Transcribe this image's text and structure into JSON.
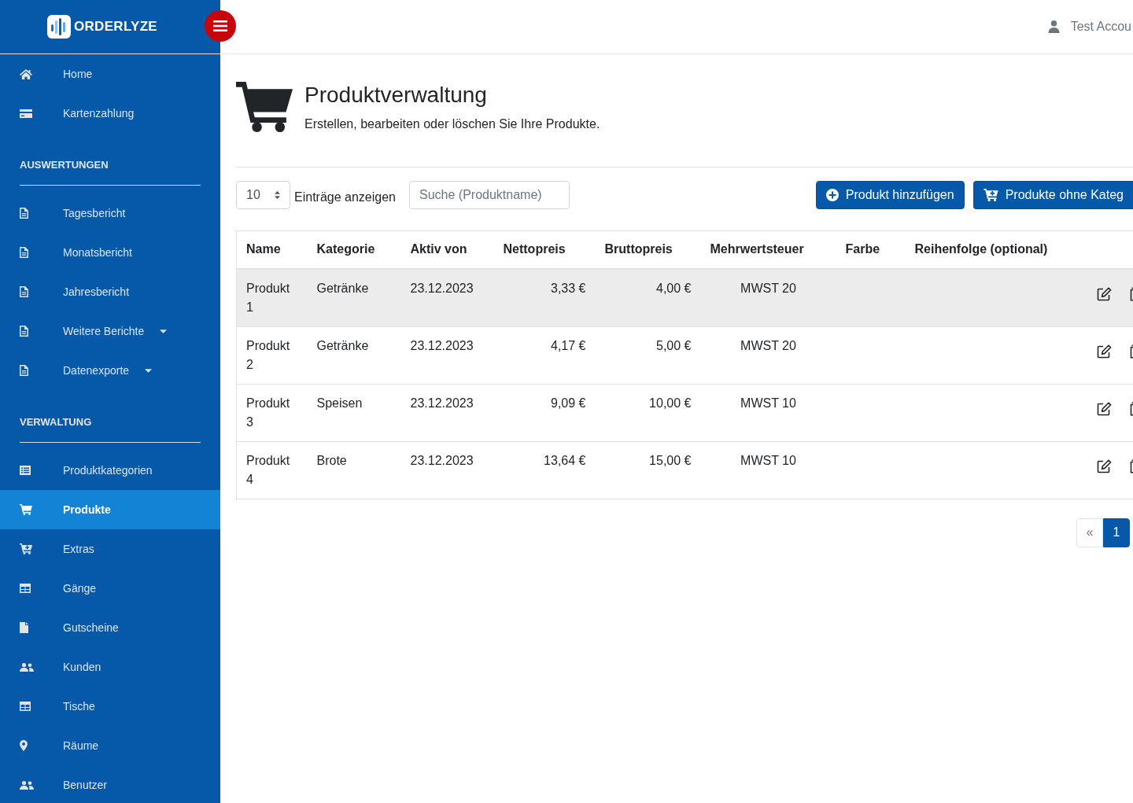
{
  "topbar": {
    "account": "Test Accou"
  },
  "sidebar": {
    "logo": "ORDERLYZE",
    "items": [
      {
        "label": "Home",
        "selected": false,
        "expandable": false
      },
      {
        "label": "Kartenzahlung",
        "selected": false,
        "expandable": false
      }
    ],
    "sections": [
      {
        "title": "AUSWERTUNGEN",
        "items": [
          {
            "label": "Tagesbericht",
            "selected": false,
            "expandable": false
          },
          {
            "label": "Monatsbericht",
            "selected": false,
            "expandable": false
          },
          {
            "label": "Jahresbericht",
            "selected": false,
            "expandable": false
          },
          {
            "label": "Weitere Berichte",
            "selected": false,
            "expandable": true
          },
          {
            "label": "Datenexporte",
            "selected": false,
            "expandable": true
          }
        ]
      },
      {
        "title": "VERWALTUNG",
        "items": [
          {
            "label": "Produktkategorien",
            "selected": false,
            "expandable": false
          },
          {
            "label": "Produkte",
            "selected": true,
            "expandable": false
          },
          {
            "label": "Extras",
            "selected": false,
            "expandable": false
          },
          {
            "label": "Gänge",
            "selected": false,
            "expandable": false
          },
          {
            "label": "Gutscheine",
            "selected": false,
            "expandable": false
          },
          {
            "label": "Kunden",
            "selected": false,
            "expandable": false
          },
          {
            "label": "Tische",
            "selected": false,
            "expandable": false
          },
          {
            "label": "Räume",
            "selected": false,
            "expandable": false
          },
          {
            "label": "Benutzer",
            "selected": false,
            "expandable": false
          }
        ]
      }
    ]
  },
  "page": {
    "title": "Produktverwaltung",
    "subtitle": "Erstellen, bearbeiten oder löschen Sie Ihre Produkte."
  },
  "toolbar": {
    "page_size": "10",
    "page_size_label": "Einträge anzeigen",
    "search": {
      "placeholder": "Suche (Produktname)"
    },
    "buttons": [
      "Produkt hinzufügen",
      "Produkte ohne Kateg"
    ]
  },
  "table": {
    "columns": [
      "Name",
      "Kategorie",
      "Aktiv von",
      "Nettopreis",
      "Bruttopreis",
      "Mehrwertsteuer",
      "Farbe",
      "Reihenfolge (optional)"
    ],
    "rows": [
      {
        "highlighted": true,
        "name": "Produkt 1",
        "category": "Getränke",
        "active_from": "23.12.2023",
        "net_price": "3,33 €",
        "gross_price": "4,00 €",
        "vat": "MWST 20"
      },
      {
        "highlighted": false,
        "name": "Produkt 2",
        "category": "Getränke",
        "active_from": "23.12.2023",
        "net_price": "4,17 €",
        "gross_price": "5,00 €",
        "vat": "MWST 20"
      },
      {
        "highlighted": false,
        "name": "Produkt 3",
        "category": "Speisen",
        "active_from": "23.12.2023",
        "net_price": "9,09 €",
        "gross_price": "10,00 €",
        "vat": "MWST 10"
      },
      {
        "highlighted": false,
        "name": "Produkt 4",
        "category": "Brote",
        "active_from": "23.12.2023",
        "net_price": "13,64 €",
        "gross_price": "15,00 €",
        "vat": "MWST 10"
      }
    ]
  },
  "pagination": [
    {
      "label": "«",
      "selected": false,
      "disabled": true
    },
    {
      "label": "1",
      "selected": true,
      "disabled": false
    }
  ]
}
